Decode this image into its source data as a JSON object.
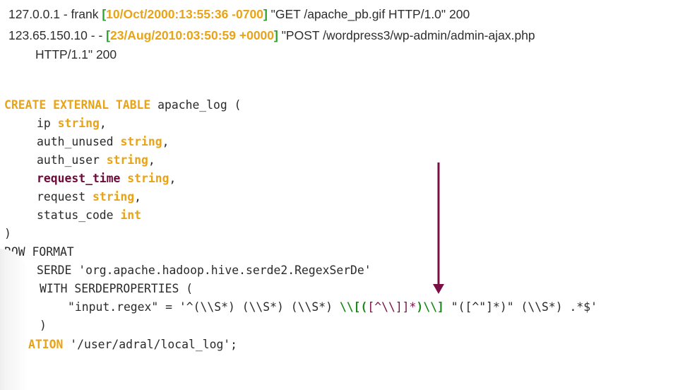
{
  "log_lines": [
    {
      "prefix": "127.0.0.1 - frank ",
      "open_bracket": "[",
      "timestamp": "10/Oct/2000:13:55:36 -0700",
      "close_bracket": "]",
      "suffix": " \"GET /apache_pb.gif HTTP/1.0\" 200"
    },
    {
      "prefix": "123.65.150.10 - - ",
      "open_bracket": "[",
      "timestamp": "23/Aug/2010:03:50:59 +0000",
      "close_bracket": "]",
      "suffix": " \"POST /wordpress3/wp-admin/admin-ajax.php",
      "continuation": "HTTP/1.1\" 200"
    }
  ],
  "sql": {
    "create_kw": "CREATE EXTERNAL TABLE",
    "table_name": " apache_log (",
    "columns": [
      {
        "name": "ip",
        "type": "string",
        "sep": ","
      },
      {
        "name": "auth_unused",
        "type": "string",
        "sep": ","
      },
      {
        "name": "auth_user",
        "type": "string",
        "sep": ","
      },
      {
        "name": "request_time",
        "type": "string",
        "sep": ","
      },
      {
        "name": "request",
        "type": "string",
        "sep": ","
      },
      {
        "name": "status_code",
        "type": "int",
        "sep": ""
      }
    ],
    "close_paren": ")",
    "row_format": "ROW FORMAT",
    "serde_line": "SERDE 'org.apache.hadoop.hive.serde2.RegexSerDe'",
    "with_line": "WITH SERDEPROPERTIES (",
    "regex_key": "\"input.regex\" = '^(\\\\S*) (\\\\S*) (\\\\S*) ",
    "regex_open": "\\\\[(",
    "regex_mid": "[^\\\\]]*",
    "regex_close": ")\\\\]",
    "regex_tail": " \"([^\"]*)\" (\\\\S*) .*$'",
    "props_close": ")",
    "location_kw": "ATION",
    "location_value": " '/user/adral/local_log';"
  },
  "colors": {
    "keyword": "#e8a317",
    "highlight": "#6e0a3a",
    "bracket": "#2ea02e",
    "arrow": "#7a0f45"
  }
}
